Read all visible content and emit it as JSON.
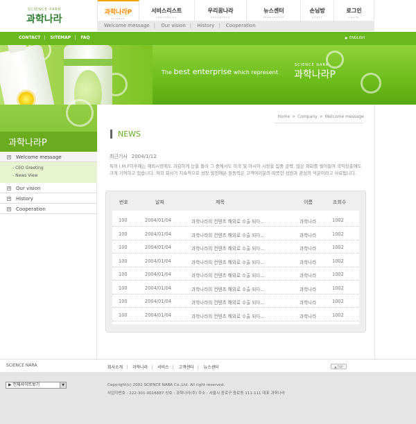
{
  "logo": {
    "sub": "SCIENCE PARK",
    "main": "과학나라"
  },
  "gnb": [
    {
      "ko": "과학나라P",
      "en": "SCIENCE",
      "active": true
    },
    {
      "ko": "서비스리스트",
      "en": "SERVICELIST"
    },
    {
      "ko": "우리꿈나라",
      "en": "DREAMTREE"
    },
    {
      "ko": "뉴스센터",
      "en": "NEWSCENTER"
    },
    {
      "ko": "손님방",
      "en": "GUEST"
    },
    {
      "ko": "로그인",
      "en": "LOGIN"
    }
  ],
  "subnav": [
    "Welcome message",
    "Our vision",
    "History",
    "Cooperation"
  ],
  "topbar": {
    "links": [
      "CONTACT",
      "SITEMAP",
      "FAQ"
    ],
    "english": "ENGLISH"
  },
  "banner": {
    "pre": "The",
    "big": "best enterprise",
    "post": "which represent",
    "brand_sub": "SCIENCE NARA",
    "brand": "과학나라P"
  },
  "sidebar": {
    "title": "과학나라P",
    "items": [
      {
        "label": "Welcome message",
        "open": true,
        "sub": [
          "CEO Greeting",
          "News View"
        ]
      },
      {
        "label": "Our vision"
      },
      {
        "label": "History"
      },
      {
        "label": "Cooperation"
      }
    ]
  },
  "breadcrumb": [
    "Home",
    "Company",
    "Welcome message"
  ],
  "news": {
    "title": "NEWS",
    "date_label": "최근기사",
    "date": "2004/1/12",
    "body": "특허 I.M.F이후에는 해외시장에도 과감하게 눈을 돌려 그 중에서도 미국 및 아시아 시장을 집중 공략, 많은 외화를 벌어들여 국익창출에도 크게 기여하고 있습니다. 저희 회사가 지속적으로 성장 발전해온 원동력은 고객여러분의 따뜻한 성원과 관심의 덕분이라고 사료됩니다."
  },
  "table": {
    "headers": [
      "번호",
      "날짜",
      "제목",
      "이름",
      "조회수"
    ],
    "rows": [
      [
        "100",
        "2004/01/04",
        "과학나라의 컨텐츠 해외로 수출 되다...",
        "과학나라",
        "1002"
      ],
      [
        "100",
        "2004/01/04",
        "과학나라의 컨텐츠 해외로 수출 되다...",
        "과학나라",
        "1002"
      ],
      [
        "100",
        "2004/01/04",
        "과학나라의 컨텐츠 해외로 수출 되다...",
        "과학나라",
        "1002"
      ],
      [
        "100",
        "2004/01/04",
        "과학나라의 컨텐츠 해외로 수출 되다...",
        "과학나라",
        "1002"
      ],
      [
        "100",
        "2004/01/04",
        "과학나라의 컨텐츠 해외로 수출 되다...",
        "과학나라",
        "1002"
      ],
      [
        "100",
        "2004/01/04",
        "과학나라의 컨텐츠 해외로 수출 되다...",
        "과학나라",
        "1002"
      ],
      [
        "100",
        "2004/01/04",
        "과학나라의 컨텐츠 해외로 수출 되다...",
        "과학나라",
        "1002"
      ],
      [
        "100",
        "2004/01/04",
        "과학나라의 컨텐츠 해외로 수출 되다...",
        "과학나라",
        "1002"
      ]
    ]
  },
  "footer": {
    "brand": "SCIENCE NARA",
    "links": [
      "회사소개",
      "과학나라",
      "서비스",
      "고객센터",
      "뉴스센터"
    ],
    "top": "▲ TOP",
    "select": "▶ 전체사이트보기",
    "copyright": "Copyright(c) 2002 SCIENCE NARA Co.,Ltd. All right reserved.",
    "address": "사업자번호 : 222-301-0016887 상호 : 과학나라(주)  주소 : 서울시 종로구 종로동 111-111 대표 과학나라"
  },
  "colors": {
    "green": "#6ab820",
    "dark_green": "#6aab1f",
    "orange": "#ff8a00"
  }
}
